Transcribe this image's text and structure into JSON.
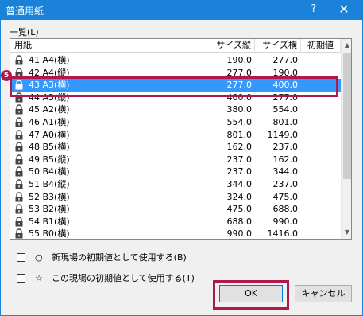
{
  "window": {
    "title": "普通用紙",
    "help": "?",
    "close": "✕"
  },
  "list": {
    "label": "一覧(L)",
    "headers": {
      "name": "用紙",
      "height": "サイズ縦",
      "width": "サイズ横",
      "default": "初期値"
    },
    "rows": [
      {
        "name": "41 A4(横)",
        "h": "190.0",
        "w": "277.0"
      },
      {
        "name": "42 A4(縦)",
        "h": "277.0",
        "w": "190.0"
      },
      {
        "name": "43 A3(横)",
        "h": "277.0",
        "w": "400.0",
        "selected": true
      },
      {
        "name": "44 A3(縦)",
        "h": "400.0",
        "w": "277.0"
      },
      {
        "name": "45 A2(横)",
        "h": "380.0",
        "w": "554.0"
      },
      {
        "name": "46 A1(横)",
        "h": "554.0",
        "w": "801.0"
      },
      {
        "name": "47 A0(横)",
        "h": "801.0",
        "w": "1149.0"
      },
      {
        "name": "48 B5(横)",
        "h": "162.0",
        "w": "237.0"
      },
      {
        "name": "49 B5(縦)",
        "h": "237.0",
        "w": "162.0"
      },
      {
        "name": "50 B4(横)",
        "h": "237.0",
        "w": "344.0"
      },
      {
        "name": "51 B4(縦)",
        "h": "344.0",
        "w": "237.0"
      },
      {
        "name": "52 B3(横)",
        "h": "324.0",
        "w": "475.0"
      },
      {
        "name": "53 B2(横)",
        "h": "475.0",
        "w": "688.0"
      },
      {
        "name": "54 B1(横)",
        "h": "688.0",
        "w": "990.0"
      },
      {
        "name": "55 B0(横)",
        "h": "990.0",
        "w": "1416.0"
      }
    ]
  },
  "callout": {
    "number": "5"
  },
  "options": {
    "new_site_default": {
      "symbol": "○",
      "label": "新現場の初期値として使用する(B)"
    },
    "this_site_default": {
      "symbol": "☆",
      "label": "この現場の初期値として使用する(T)"
    }
  },
  "buttons": {
    "ok": "OK",
    "cancel": "キャンセル"
  },
  "colors": {
    "titlebar": "#1a82d8",
    "selection": "#3399ff",
    "callout": "#b0184c"
  }
}
